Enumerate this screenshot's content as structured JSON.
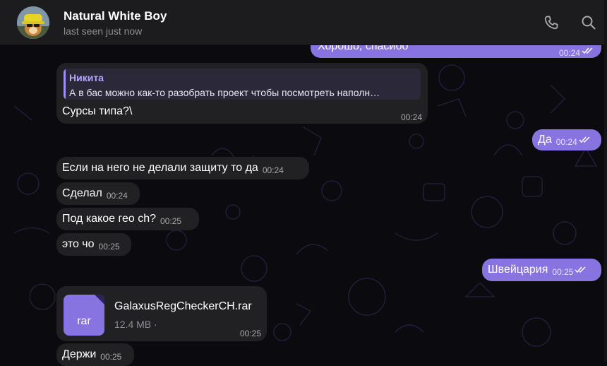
{
  "header": {
    "title": "Natural White Boy",
    "status": "last seen just now",
    "call_icon": "phone-icon",
    "search_icon": "search-icon"
  },
  "colors": {
    "accent": "#8774e1",
    "incoming_bubble": "#212123",
    "background": "#0b0a0f",
    "header": "#1c1c1e"
  },
  "messages": [
    {
      "direction": "out",
      "text": "Хорошо, спасибо",
      "time": "00:24",
      "status": "read"
    },
    {
      "direction": "in",
      "reply_to": {
        "name": "Никита",
        "text": "А в бас можно как-то разобрать проект чтобы посмотреть наполн…"
      },
      "text": "Сурсы типа?\\",
      "time": "00:24"
    },
    {
      "direction": "out",
      "text": "Да",
      "time": "00:24",
      "status": "read"
    },
    {
      "direction": "in",
      "text": "Если на него не делали защиту то да",
      "time": "00:24"
    },
    {
      "direction": "in",
      "text": "Сделал",
      "time": "00:24"
    },
    {
      "direction": "in",
      "text": "Под какое гео ch?",
      "time": "00:25"
    },
    {
      "direction": "in",
      "text": "это чо",
      "time": "00:25"
    },
    {
      "direction": "out",
      "text": "Швейцария",
      "time": "00:25",
      "status": "read"
    },
    {
      "direction": "in",
      "file": {
        "ext": "rar",
        "name": "GalaxusRegCheckerCH.rar",
        "size": "12.4 MB ·"
      },
      "time": "00:25"
    },
    {
      "direction": "in",
      "text": "Держи",
      "time": "00:25"
    }
  ]
}
